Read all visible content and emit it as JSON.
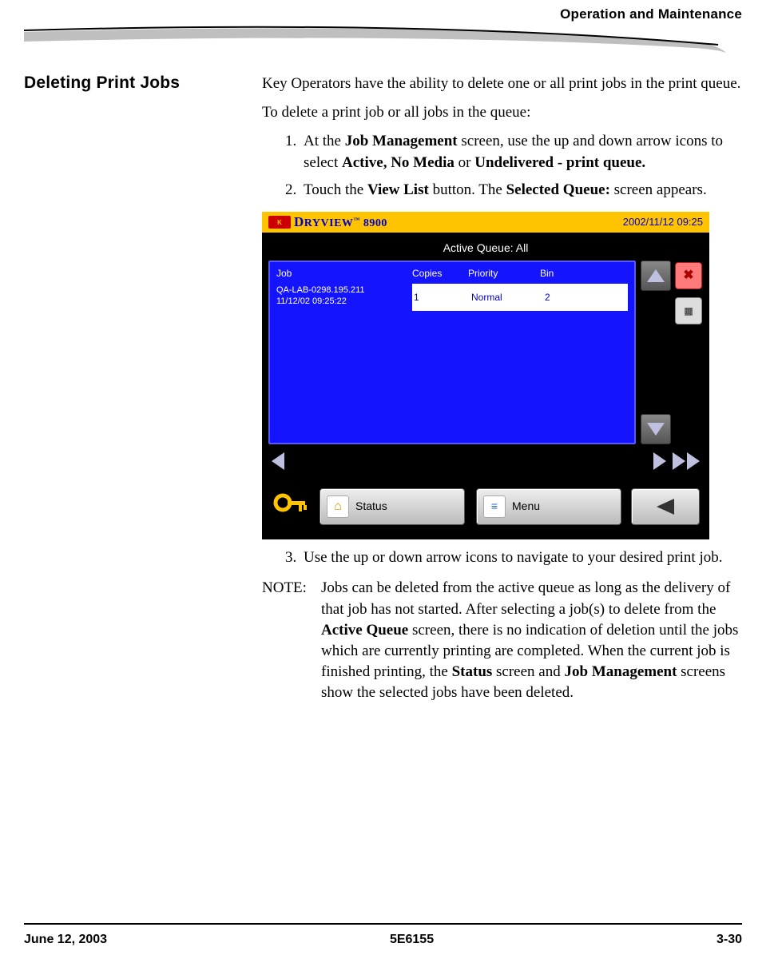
{
  "header": {
    "running_head": "Operation and Maintenance"
  },
  "section": {
    "title": "Deleting Print Jobs"
  },
  "body": {
    "intro1": "Key Operators have the ability to delete one or all print jobs in the print queue.",
    "intro2": "To delete a print job or all jobs in the queue:",
    "step1_pre": "At the ",
    "step1_b1": "Job Management",
    "step1_mid": " screen, use the up and down arrow icons to select ",
    "step1_b2": "Active, No Media",
    "step1_mid2": " or ",
    "step1_b3": "Undelivered - print queue.",
    "step2_pre": "Touch the ",
    "step2_b1": "View List",
    "step2_mid": " button. The ",
    "step2_b2": "Selected Queue:",
    "step2_post": " screen appears.",
    "step3": "Use the up or down arrow icons to navigate to your desired print job.",
    "note_label": "NOTE:",
    "note_pre": "Jobs can be deleted from the active queue as long as the delivery of that job has not started. After selecting a job(s) to delete from the ",
    "note_b1": "Active Queue",
    "note_mid1": " screen, there is no indication of deletion until the jobs which are currently printing are completed. When the current job is finished printing, the ",
    "note_b2": "Status",
    "note_mid2": " screen and ",
    "note_b3": "Job Management",
    "note_post": " screens show the selected jobs have been deleted."
  },
  "screenshot": {
    "brand_prefix": "D",
    "brand_rest": "RYVIEW",
    "brand_model": "8900",
    "tm": "™",
    "timestamp": "2002/11/12 09:25",
    "screen_title": "Active Queue: All",
    "th_job": "Job",
    "th_copies": "Copies",
    "th_priority": "Priority",
    "th_bin": "Bin",
    "row_job_l1": "QA-LAB-0298.195.211",
    "row_job_l2": "11/12/02 09:25:22",
    "row_copies": "1",
    "row_priority": "Normal",
    "row_bin": "2",
    "btn_status": "Status",
    "btn_menu": "Menu"
  },
  "footer": {
    "left": "June 12, 2003",
    "center": "5E6155",
    "right": "3-30"
  }
}
